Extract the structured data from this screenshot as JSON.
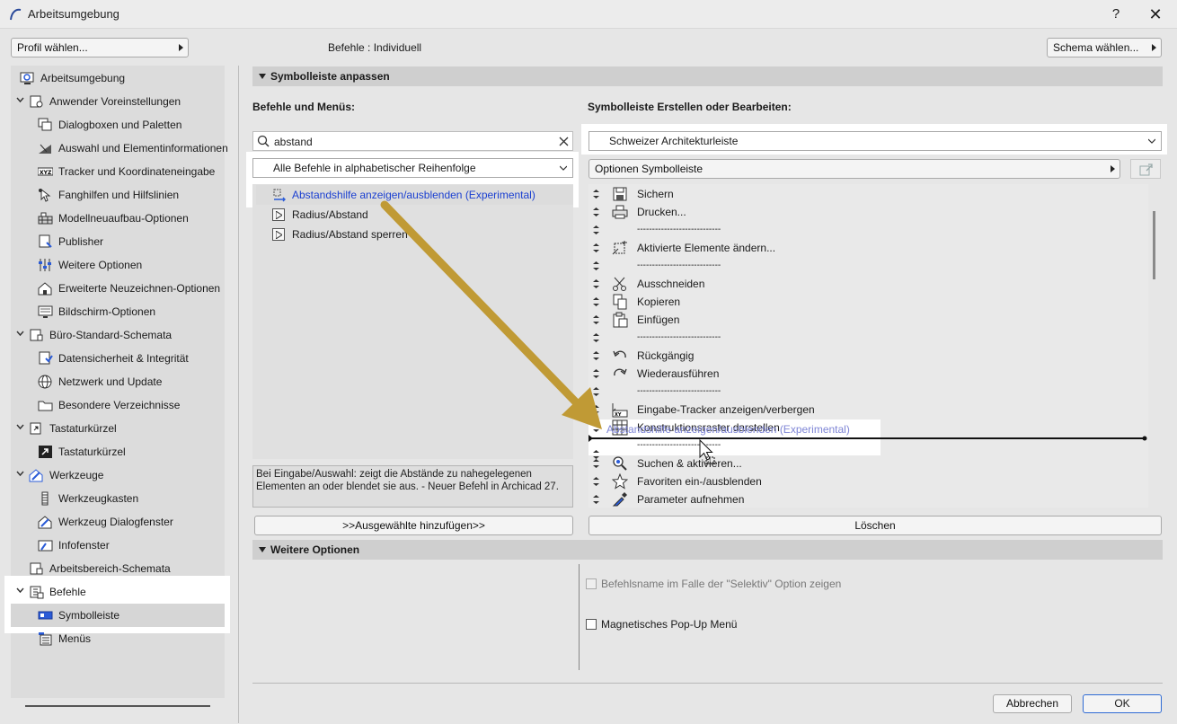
{
  "window": {
    "title": "Arbeitsumgebung",
    "help_label": "?",
    "close_label": "✕"
  },
  "top": {
    "profile_button": "Profil wählen...",
    "befehle_label": "Befehle :  Individuell",
    "schema_button": "Schema wählen..."
  },
  "sidebar": {
    "items": [
      {
        "label": "Arbeitsumgebung"
      },
      {
        "label": "Anwender Voreinstellungen"
      },
      {
        "label": "Dialogboxen und Paletten"
      },
      {
        "label": "Auswahl und Elementinformationen"
      },
      {
        "label": "Tracker und Koordinateneingabe"
      },
      {
        "label": "Fanghilfen und Hilfslinien"
      },
      {
        "label": "Modellneuaufbau-Optionen"
      },
      {
        "label": "Publisher"
      },
      {
        "label": "Weitere Optionen"
      },
      {
        "label": "Erweiterte Neuzeichnen-Optionen"
      },
      {
        "label": "Bildschirm-Optionen"
      },
      {
        "label": "Büro-Standard-Schemata"
      },
      {
        "label": "Datensicherheit & Integrität"
      },
      {
        "label": "Netzwerk und Update"
      },
      {
        "label": "Besondere Verzeichnisse"
      },
      {
        "label": "Tastaturkürzel"
      },
      {
        "label": "Tastaturkürzel"
      },
      {
        "label": "Werkzeuge"
      },
      {
        "label": "Werkzeugkasten"
      },
      {
        "label": "Werkzeug Dialogfenster"
      },
      {
        "label": "Infofenster"
      },
      {
        "label": "Arbeitsbereich-Schemata"
      },
      {
        "label": "Befehle"
      },
      {
        "label": "Symbolleiste"
      },
      {
        "label": "Menüs"
      }
    ]
  },
  "main": {
    "section_title": "Symbolleiste anpassen",
    "left_heading": "Befehle und Menüs:",
    "right_heading": "Symbolleiste Erstellen oder Bearbeiten:",
    "search_value": "abstand",
    "filter_select": "Alle Befehle in alphabetischer Reihenfolge",
    "commands": [
      {
        "label": "Abstandshilfe anzeigen/ausblenden (Experimental)"
      },
      {
        "label": "Radius/Abstand"
      },
      {
        "label": "Radius/Abstand sperren"
      }
    ],
    "description": "Bei Eingabe/Auswahl: zeigt die Abstände zu nahegelegenen Elementen an oder blendet sie aus. - Neuer Befehl in Archicad 27.",
    "add_button": ">>Ausgewählte hinzufügen>>",
    "toolbar_select": "Schweizer Architekturleiste",
    "toolbar_options": "Optionen Symbolleiste",
    "toolbar_items": [
      {
        "label": "Sichern",
        "icon": "save-icon"
      },
      {
        "label": "Drucken...",
        "icon": "print-icon"
      },
      {
        "label": "----------------------------",
        "icon": ""
      },
      {
        "label": "Aktivierte Elemente ändern...",
        "icon": "transform-icon"
      },
      {
        "label": "----------------------------",
        "icon": ""
      },
      {
        "label": "Ausschneiden",
        "icon": "scissors-icon"
      },
      {
        "label": "Kopieren",
        "icon": "copy-icon"
      },
      {
        "label": "Einfügen",
        "icon": "paste-icon"
      },
      {
        "label": "----------------------------",
        "icon": ""
      },
      {
        "label": "Rückgängig",
        "icon": "undo-icon"
      },
      {
        "label": "Wiederausführen",
        "icon": "redo-icon"
      },
      {
        "label": "----------------------------",
        "icon": ""
      },
      {
        "label": "Eingabe-Tracker anzeigen/verbergen",
        "icon": "tracker-icon"
      },
      {
        "label": "Konstruktionsraster darstellen",
        "icon": "grid-icon"
      },
      {
        "label": "----------------------------",
        "icon": ""
      },
      {
        "label": "Suchen & aktivieren...",
        "icon": "find-icon"
      },
      {
        "label": "Favoriten ein-/ausblenden",
        "icon": "star-icon"
      },
      {
        "label": "Parameter aufnehmen",
        "icon": "eyedropper-icon"
      }
    ],
    "drag_ghost_label": "Abstandshilfe anzeigen/ausblenden (Experimental)",
    "delete_button": "Löschen"
  },
  "weitere": {
    "section_title": "Weitere Optionen",
    "option1": "Befehlsname im Falle der \"Selektiv\" Option zeigen",
    "option2": "Magnetisches Pop-Up Menü"
  },
  "footer": {
    "cancel": "Abbrechen",
    "ok": "OK"
  },
  "colors": {
    "accent": "#2f6bd4",
    "link_blue": "#1a3fd1",
    "arrow": "#c09a35",
    "section_bg": "#cfcfcf"
  }
}
